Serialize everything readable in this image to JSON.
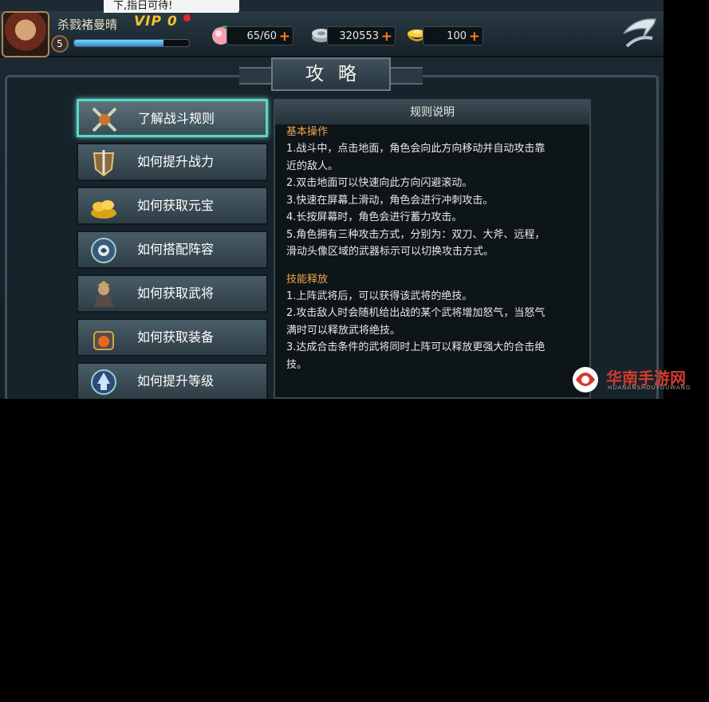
{
  "notice": "下,指日可待!",
  "player": {
    "name": "杀戮褚曼晴",
    "vip": "VIP 0",
    "level": "5",
    "exp_fraction": 0.78
  },
  "resources": [
    {
      "icon": "peach-icon",
      "value": "65/60"
    },
    {
      "icon": "silver-coin-icon",
      "value": "320553"
    },
    {
      "icon": "gold-ingot-icon",
      "value": "100"
    }
  ],
  "title": "攻略",
  "menu": [
    {
      "label": "了解战斗规则",
      "icon": "crossed-swords-icon",
      "active": true
    },
    {
      "label": "如何提升战力",
      "icon": "shield-sword-icon",
      "active": false
    },
    {
      "label": "如何获取元宝",
      "icon": "gold-pile-icon",
      "active": false
    },
    {
      "label": "如何搭配阵容",
      "icon": "formation-icon",
      "active": false
    },
    {
      "label": "如何获取武将",
      "icon": "general-icon",
      "active": false
    },
    {
      "label": "如何获取装备",
      "icon": "equipment-icon",
      "active": false
    },
    {
      "label": "如何提升等级",
      "icon": "level-up-icon",
      "active": false
    }
  ],
  "panel": {
    "title": "规则说明",
    "sections": [
      {
        "title": "基本操作",
        "lines": [
          "1.战斗中，点击地面，角色会向此方向移动并自动攻击靠",
          "近的敌人。",
          "2.双击地面可以快速向此方向闪避滚动。",
          "3.快速在屏幕上滑动，角色会进行冲刺攻击。",
          "4.长按屏幕时，角色会进行蓄力攻击。",
          "5.角色拥有三种攻击方式，分别为：双刀、大斧、远程，",
          "滑动头像区域的武器标示可以切换攻击方式。"
        ]
      },
      {
        "title": "技能释放",
        "lines": [
          "1.上阵武将后，可以获得该武将的绝技。",
          "2.攻击敌人时会随机给出战的某个武将增加怒气，当怒气",
          "满时可以释放武将绝技。",
          "3.达成合击条件的武将同时上阵可以释放更强大的合击绝",
          "技。"
        ]
      }
    ]
  },
  "watermark": {
    "text": "华南手游网",
    "sub": "HUANANSHOUYOUWANG"
  },
  "colors": {
    "accent": "#5fd6c5",
    "section_title": "#f0a64a",
    "plus": "#ff7a1a",
    "vip": "#f2c233"
  }
}
